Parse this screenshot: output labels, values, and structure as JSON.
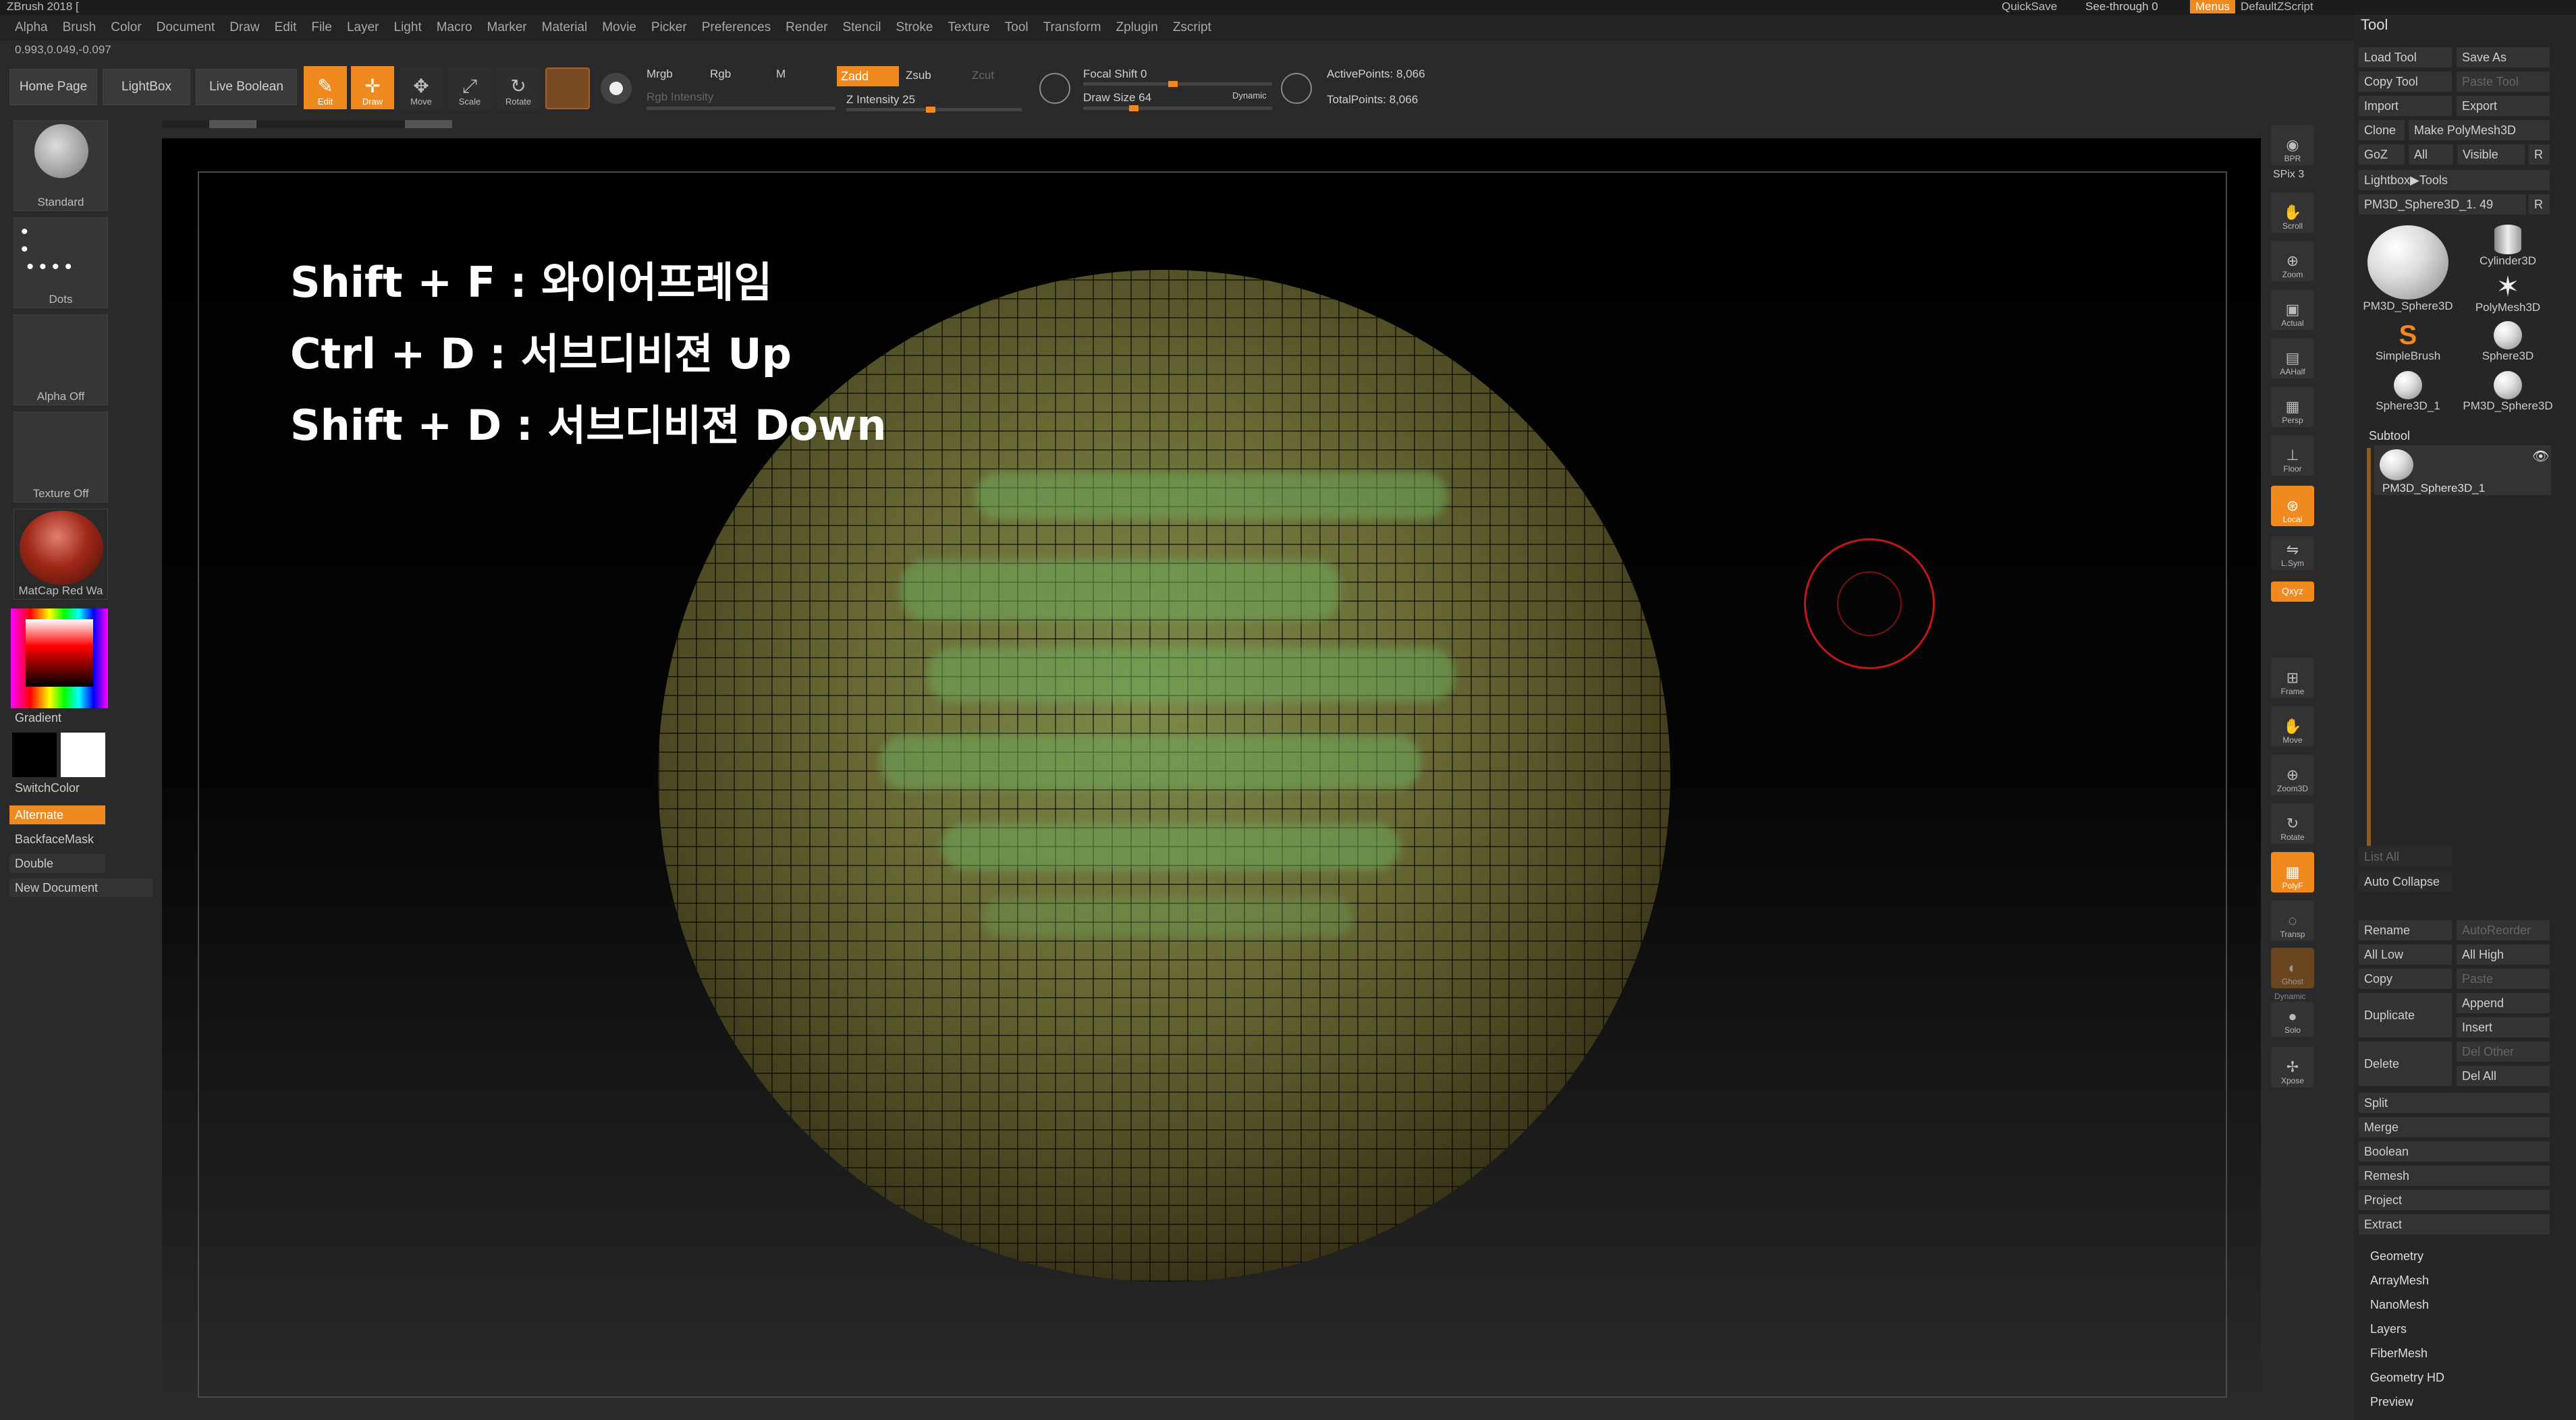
{
  "app": {
    "title": "ZBrush 2018 [",
    "coords": "0.993,0.049,-0.097"
  },
  "titlebar": {
    "quicksave": "QuickSave",
    "seethrough": "See-through  0",
    "menus": "Menus",
    "script": "DefaultZScript"
  },
  "menu": [
    "Alpha",
    "Brush",
    "Color",
    "Document",
    "Draw",
    "Edit",
    "File",
    "Layer",
    "Light",
    "Macro",
    "Marker",
    "Material",
    "Movie",
    "Picker",
    "Preferences",
    "Render",
    "Stencil",
    "Stroke",
    "Texture",
    "Tool",
    "Transform",
    "Zplugin",
    "Zscript"
  ],
  "shelf": {
    "home": "Home Page",
    "lightbox": "LightBox",
    "liveboolean": "Live Boolean",
    "edit": "Edit",
    "draw": "Draw",
    "move": "Move",
    "scale": "Scale",
    "rotate": "Rotate",
    "mrgb": "Mrgb",
    "rgb": "Rgb",
    "m": "M",
    "rgb_intensity": "Rgb Intensity",
    "zadd": "Zadd",
    "zsub": "Zsub",
    "zcut": "Zcut",
    "z_intensity": "Z Intensity 25",
    "focal_shift": "Focal Shift 0",
    "draw_size": "Draw Size 64",
    "dynamic": "Dynamic",
    "active_points": "ActivePoints: 8,066",
    "total_points": "TotalPoints: 8,066"
  },
  "left": {
    "standard": "Standard",
    "dots": "Dots",
    "alpha": "Alpha Off",
    "texture": "Texture Off",
    "matcap": "MatCap Red Wa",
    "gradient": "Gradient",
    "switchcolor": "SwitchColor",
    "alternate": "Alternate",
    "backfacemask": "BackfaceMask",
    "double": "Double",
    "newdoc": "New Document"
  },
  "overlay": {
    "line1": "Shift + F : 와이어프레임",
    "line2": "Ctrl + D : 서브디비젼 Up",
    "line3": "Shift + D : 서브디비젼 Down"
  },
  "rightbar": {
    "bpr": "BPR",
    "spix": "SPix 3",
    "scroll": "Scroll",
    "zoom": "Zoom",
    "actual": "Actual",
    "aahalf": "AAHalf",
    "persp": "Persp",
    "floor": "Floor",
    "local": "Local",
    "lsym": "L.Sym",
    "xyz": "Qxyz",
    "frame": "Frame",
    "move": "Move",
    "zoom3d": "Zoom3D",
    "rotate": "Rotate",
    "polyf": "PolyF",
    "transp": "Transp",
    "ghost": "Ghost",
    "solo": "Solo",
    "xpose": "Xpose",
    "dynamic": "Dynamic"
  },
  "tool": {
    "title": "Tool",
    "load": "Load Tool",
    "save": "Save As",
    "copy": "Copy Tool",
    "paste": "Paste Tool",
    "import": "Import",
    "export": "Export",
    "clone": "Clone",
    "makepoly": "Make PolyMesh3D",
    "goz": "GoZ",
    "all": "All",
    "visible": "Visible",
    "r": "R",
    "lightbox_tools": "Lightbox▶Tools",
    "current": "PM3D_Sphere3D_1. 49",
    "thumbs": [
      "PM3D_Sphere3D",
      "Cylinder3D",
      "PolyMesh3D",
      "SimpleBrush",
      "Sphere3D",
      "Sphere3D_1",
      "PM3D_Sphere3D"
    ],
    "subtool": "Subtool",
    "subtool_name": "PM3D_Sphere3D_1",
    "listall": "List All",
    "autocollapse": "Auto Collapse",
    "rename": "Rename",
    "autoreorder": "AutoReorder",
    "alllow": "All Low",
    "allhigh": "All High",
    "copy2": "Copy",
    "paste2": "Paste",
    "duplicate": "Duplicate",
    "append": "Append",
    "insert": "Insert",
    "delete": "Delete",
    "delother": "Del Other",
    "delall": "Del All",
    "split": "Split",
    "merge": "Merge",
    "boolean": "Boolean",
    "remesh": "Remesh",
    "project": "Project",
    "extract": "Extract",
    "sections": [
      "Geometry",
      "ArrayMesh",
      "NanoMesh",
      "Layers",
      "FiberMesh",
      "Geometry HD",
      "Preview"
    ]
  }
}
